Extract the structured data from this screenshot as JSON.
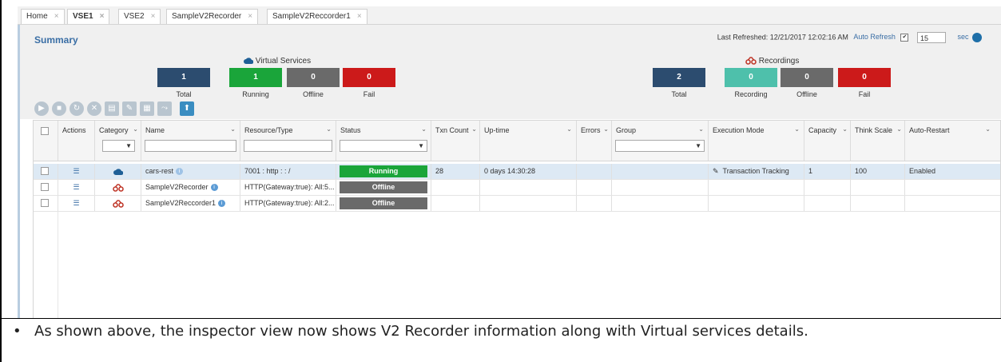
{
  "tabs": [
    {
      "label": "Home",
      "close": "×"
    },
    {
      "label": "VSE1",
      "close": "×"
    },
    {
      "label": "VSE2",
      "close": "×"
    },
    {
      "label": "SampleV2Recorder",
      "close": "×"
    },
    {
      "label": "SampleV2Reccorder1",
      "close": "×"
    }
  ],
  "summary": {
    "title": "Summary",
    "last_refreshed_label": "Last Refreshed: 12/21/2017 12:02:16 AM",
    "auto_refresh_label": "Auto Refresh",
    "auto_refresh_checked": "✔",
    "interval_value": "15",
    "interval_unit": "sec"
  },
  "virtual_services": {
    "heading": "Virtual Services",
    "stats": [
      {
        "value": "1",
        "label": "Total",
        "color": "#2c4c6f"
      },
      {
        "value": "1",
        "label": "Running",
        "color": "#1aa53a"
      },
      {
        "value": "0",
        "label": "Offline",
        "color": "#6a6a6a"
      },
      {
        "value": "0",
        "label": "Fail",
        "color": "#cc1a1a"
      }
    ]
  },
  "recordings": {
    "heading": "Recordings",
    "stats": [
      {
        "value": "2",
        "label": "Total",
        "color": "#2c4c6f"
      },
      {
        "value": "0",
        "label": "Recording",
        "color": "#4ec0ab"
      },
      {
        "value": "0",
        "label": "Offline",
        "color": "#6a6a6a"
      },
      {
        "value": "0",
        "label": "Fail",
        "color": "#cc1a1a"
      }
    ]
  },
  "toolbar_icons": [
    "play-icon",
    "stop-icon",
    "refresh-icon",
    "delete-icon",
    "document-icon",
    "settings-icon",
    "save-icon",
    "deploy-icon",
    "upload-icon"
  ],
  "columns": {
    "actions": "Actions",
    "category": "Category",
    "name": "Name",
    "resource": "Resource/Type",
    "status": "Status",
    "txn_count": "Txn Count",
    "uptime": "Up-time",
    "errors": "Errors",
    "group": "Group",
    "exec_mode": "Execution Mode",
    "capacity": "Capacity",
    "think_scale": "Think Scale",
    "auto_restart": "Auto-Restart"
  },
  "rows": [
    {
      "name": "cars-rest",
      "resource": "7001 : http : : /",
      "status": "Running",
      "status_color": "#1aa53a",
      "txn_count": "28",
      "uptime": "0 days 14:30:28",
      "exec_mode": "Transaction Tracking",
      "capacity": "1",
      "think_scale": "100",
      "auto_restart": "Enabled"
    },
    {
      "name": "SampleV2Recorder",
      "resource": "HTTP(Gateway:true): All:5...",
      "status": "Offline",
      "status_color": "#6a6a6a",
      "txn_count": "",
      "uptime": "",
      "exec_mode": "",
      "capacity": "",
      "think_scale": "",
      "auto_restart": ""
    },
    {
      "name": "SampleV2Reccorder1",
      "resource": "HTTP(Gateway:true): All:2...",
      "status": "Offline",
      "status_color": "#6a6a6a",
      "txn_count": "",
      "uptime": "",
      "exec_mode": "",
      "capacity": "",
      "think_scale": "",
      "auto_restart": ""
    }
  ],
  "note": {
    "bullet": "•",
    "text": "As shown above, the inspector view now shows V2 Recorder information along with Virtual services details."
  }
}
